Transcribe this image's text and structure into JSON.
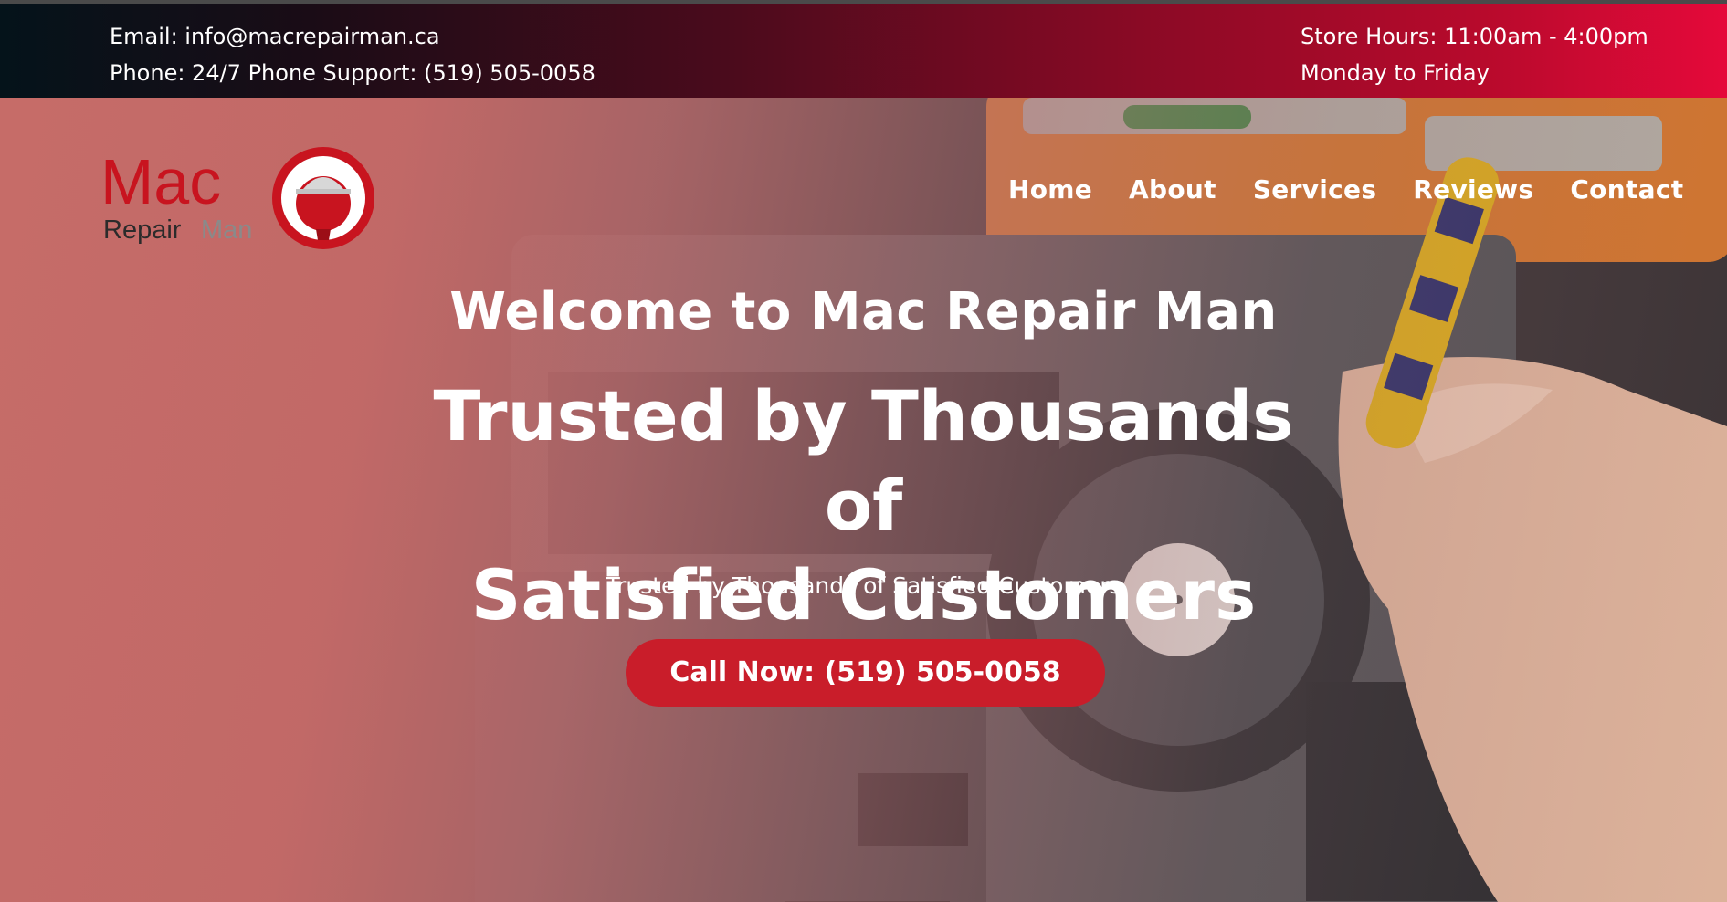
{
  "topbar": {
    "email": "Email: info@macrepairman.ca",
    "phone": "Phone: 24/7 Phone Support: (519) 505-0058",
    "hours": "Store Hours: 11:00am - 4:00pm",
    "days": "Monday to Friday"
  },
  "logo": {
    "word1": "Mac",
    "word2": "Repair",
    "word3": "Man"
  },
  "nav": {
    "items": [
      {
        "label": "Home"
      },
      {
        "label": "About"
      },
      {
        "label": "Services"
      },
      {
        "label": "Reviews"
      },
      {
        "label": "Contact"
      }
    ]
  },
  "hero": {
    "welcome": "Welcome to Mac Repair Man",
    "headline_line1": "Trusted by Thousands of",
    "headline_line2": "Satisfied Customers",
    "subheadline": "Trusted by Thousands of Satisfied Customers",
    "cta_label": "Call Now: (519) 505-0058"
  },
  "colors": {
    "accent_red": "#c91d2a",
    "topbar_dark": "#04131a",
    "topbar_red": "#e5093a",
    "hero_tint": "#c66c68"
  },
  "icons": {
    "logo_mark": "apple-repairman-icon"
  }
}
